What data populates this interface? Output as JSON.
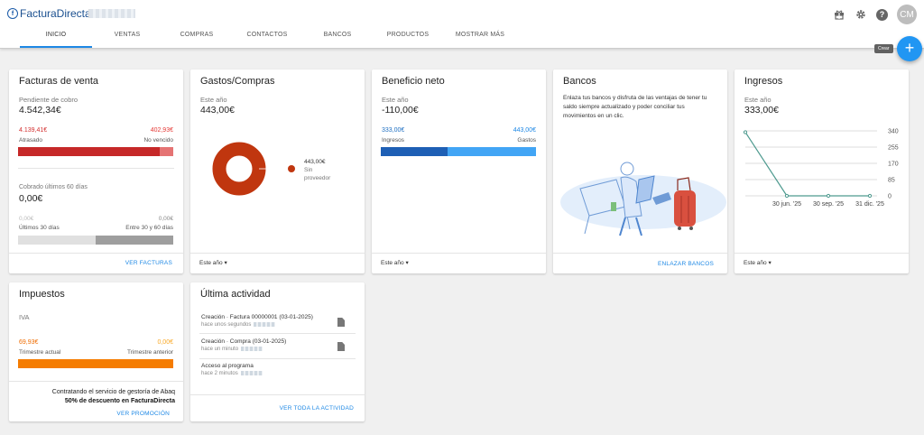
{
  "app": {
    "name": "FacturaDirecta"
  },
  "nav": {
    "tabs": [
      "INICIO",
      "VENTAS",
      "COMPRAS",
      "CONTACTOS",
      "BANCOS",
      "PRODUCTOS",
      "MOSTRAR MÁS"
    ],
    "active": "INICIO"
  },
  "user": {
    "initials": "CM"
  },
  "fab": {
    "label": "+",
    "tooltip": "Crear"
  },
  "ventas": {
    "title": "Facturas de venta",
    "pending_label": "Pendiente de cobro",
    "pending_value": "4.542,34€",
    "overdue_value": "4.139,41€",
    "overdue_label": "Atrasado",
    "notdue_value": "402,93€",
    "notdue_label": "No vencido",
    "overdue_fraction": 0.91,
    "collected_label": "Cobrado últimos 60 días",
    "collected_value": "0,00€",
    "last30_value": "0,00€",
    "last30_label": "Últimos 30 días",
    "range_value": "0,00€",
    "range_label": "Entre 30 y 60 días",
    "link": "VER FACTURAS"
  },
  "gastos": {
    "title": "Gastos/Compras",
    "period_label": "Este año",
    "value": "443,00€",
    "legend_value": "443,00€",
    "legend_label_1": "Sin",
    "legend_label_2": "proveedor",
    "filter": "Este año",
    "color": "#c0360f"
  },
  "beneficio": {
    "title": "Beneficio neto",
    "period_label": "Este año",
    "value": "-110,00€",
    "income_value": "333,00€",
    "income_label": "Ingresos",
    "expense_value": "443,00€",
    "expense_label": "Gastos",
    "income_fraction": 0.43,
    "filter": "Este año"
  },
  "bancos": {
    "title": "Bancos",
    "text": "Enlaza tus bancos y disfruta de las ventajas de tener tu saldo siempre actualizado y poder conciliar tus movimientos en un clic.",
    "link": "ENLAZAR BANCOS"
  },
  "ingresos": {
    "title": "Ingresos",
    "period_label": "Este año",
    "value": "333,00€",
    "filter": "Este año"
  },
  "chart_data": {
    "type": "line",
    "title": "Ingresos",
    "x": [
      "",
      "30 jun. '25",
      "30 sep. '25",
      "31 dic. '25"
    ],
    "values": [
      333,
      0,
      0,
      0
    ],
    "y_ticks": [
      "340",
      "255",
      "170",
      "85",
      "0"
    ],
    "ylim": [
      0,
      340
    ],
    "xlabel": "",
    "ylabel": ""
  },
  "impuestos": {
    "title": "Impuestos",
    "tax_label": "IVA",
    "current_value": "69,93€",
    "current_label": "Trimestre actual",
    "previous_value": "0,00€",
    "previous_label": "Trimestre anterior",
    "promo_line1": "Contratando el servicio de gestoría de Abaq",
    "promo_line2": "50% de descuento en FacturaDirecta",
    "link": "VER PROMOCIÓN"
  },
  "actividad": {
    "title": "Última actividad",
    "items": [
      {
        "title": "Creación · Factura 00000001 (03-01-2025)",
        "sub": "hace unos segundos"
      },
      {
        "title": "Creación · Compra (03-01-2025)",
        "sub": "hace un minuto"
      },
      {
        "title": "Acceso al programa",
        "sub": "hace 2 minutos"
      }
    ],
    "link": "VER TODA LA ACTIVIDAD"
  }
}
